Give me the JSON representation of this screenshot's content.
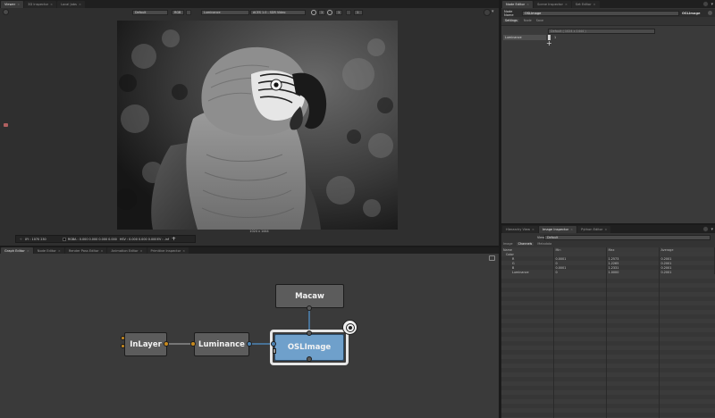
{
  "viewer": {
    "tabs": [
      {
        "label": "Viewer",
        "active": true
      },
      {
        "label": "3D Inspector",
        "active": false
      },
      {
        "label": "Local Jobs",
        "active": false
      }
    ],
    "toolbar": {
      "display_dropdown": "Default",
      "channel_dropdown": "RGB",
      "view_dropdown": "Luminance",
      "colorspace_dropdown": "ACES 1.0 - SDR Video",
      "gain_value": "1",
      "gamma_value": "1"
    },
    "image_size_label": "1024 x 1444",
    "statusbar": {
      "xy": "XY : 1070 230",
      "rgba": "RGBA : 0.000 0.000 0.000 0.000",
      "hsv": "HSV : 0.000 0.000 0.000",
      "ev": "EV : -inf",
      "add_label": "+"
    }
  },
  "node_editor": {
    "tabs": [
      {
        "label": "Node Editor",
        "active": true
      },
      {
        "label": "Scene Inspector",
        "active": false
      },
      {
        "label": "Set Editor",
        "active": false
      }
    ],
    "node_name_label": "Node Name",
    "node_name_value": "OSLImage",
    "node_type": "OSLImage",
    "section_tabs": [
      "Settings",
      "Node",
      "Save"
    ],
    "format_dropdown": "Default ( 1024 x 1444 )",
    "param_label": "Luminance",
    "param_value": "1",
    "add_label": "+"
  },
  "graph_editor": {
    "tabs": [
      {
        "label": "Graph Editor",
        "active": true
      },
      {
        "label": "Node Editor",
        "active": false
      },
      {
        "label": "Render Pass Editor",
        "active": false
      },
      {
        "label": "Animation Editor",
        "active": false
      },
      {
        "label": "Primitive Inspector",
        "active": false
      }
    ],
    "nodes": {
      "macaw": "Macaw",
      "inlayer": "InLayer",
      "luminance": "Luminance",
      "oslimage": "OSLImage"
    }
  },
  "image_inspector": {
    "tabs": [
      {
        "label": "Hierarchy View",
        "active": false
      },
      {
        "label": "Image Inspector",
        "active": true
      },
      {
        "label": "Python Editor",
        "active": false
      }
    ],
    "view_label": "View",
    "view_dropdown": "Default",
    "sub_tabs": [
      "Image",
      "Channels",
      "Metadata"
    ],
    "columns": [
      "Name",
      "Min",
      "Max",
      "Average"
    ],
    "rows": [
      [
        "Color",
        "",
        "",
        ""
      ],
      [
        "R",
        "0.0001",
        "1.2573",
        "0.2001"
      ],
      [
        "G",
        "0",
        "1.2265",
        "0.2001"
      ],
      [
        "B",
        "0.0001",
        "1.2331",
        "0.2001"
      ],
      [
        "Luminance",
        "0",
        "1.0000",
        "0.2001"
      ]
    ]
  },
  "colors": {
    "accent_blue": "#4d84b5",
    "port_orange": "#c88a1e",
    "panel_bg": "#333333"
  }
}
